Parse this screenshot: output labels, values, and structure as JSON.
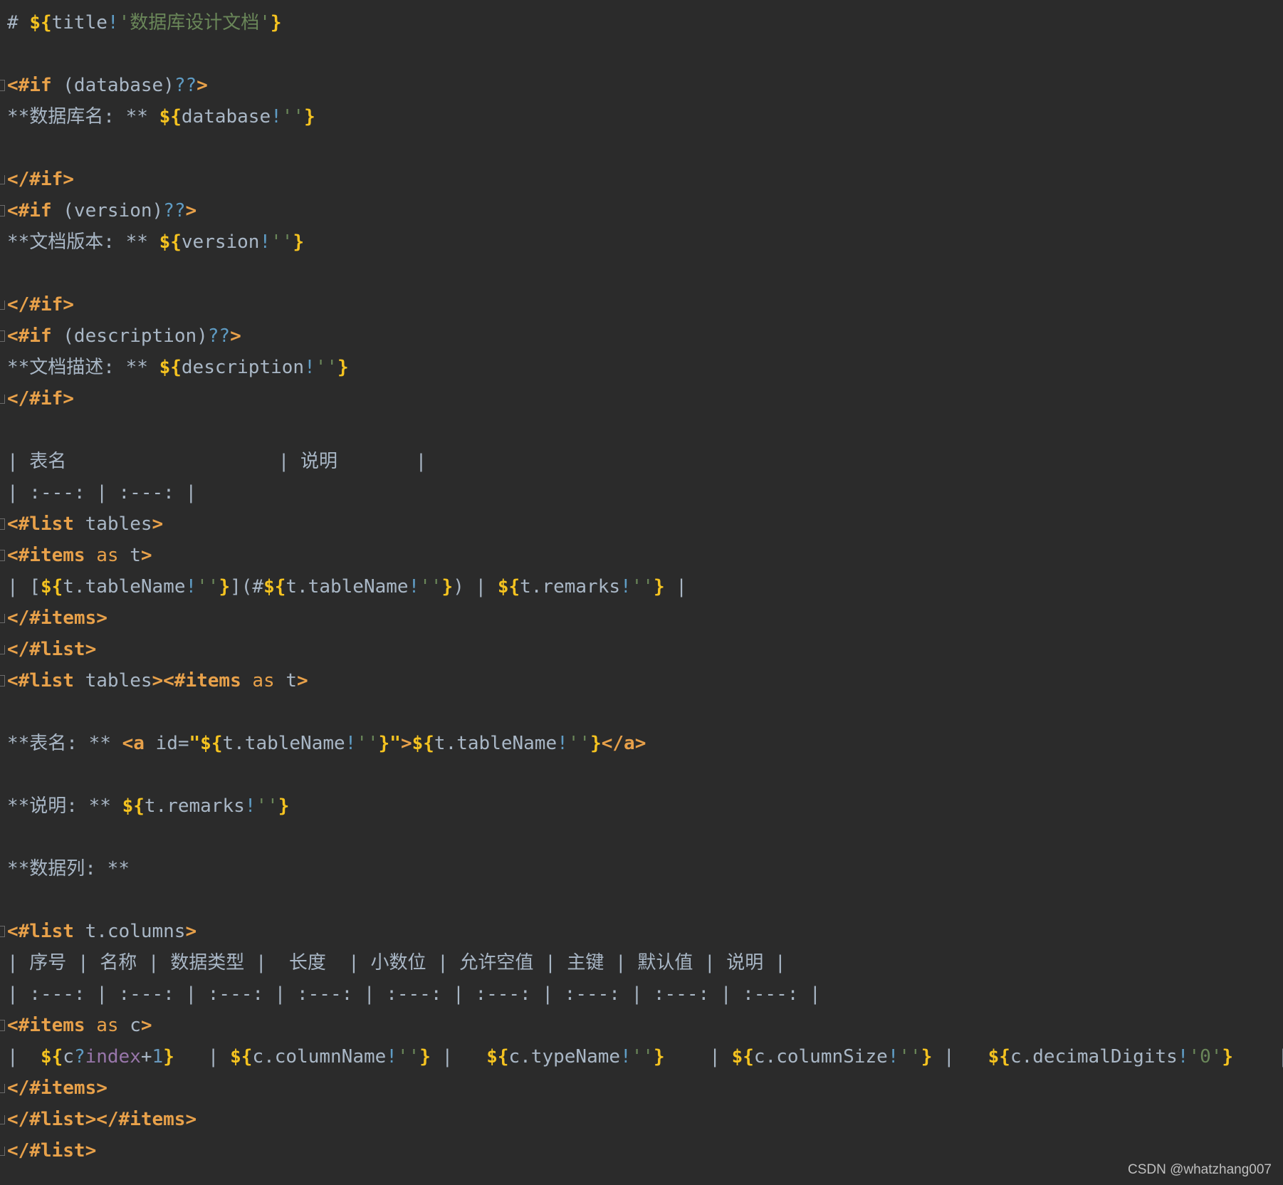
{
  "editor": {
    "lines": [
      {
        "fold": "",
        "tokens": [
          [
            "plain",
            "# "
          ],
          [
            "interp",
            "${"
          ],
          [
            "plain",
            "title"
          ],
          [
            "op",
            "!"
          ],
          [
            "str",
            "'数据库设计文档'"
          ],
          [
            "interp",
            "}"
          ]
        ]
      },
      {
        "fold": "",
        "tokens": []
      },
      {
        "fold": "start",
        "tokens": [
          [
            "tag",
            "<#if "
          ],
          [
            "plain",
            "(database)"
          ],
          [
            "op",
            "??"
          ],
          [
            "tag",
            ">"
          ]
        ]
      },
      {
        "fold": "",
        "tokens": [
          [
            "plain",
            "**数据库名: ** "
          ],
          [
            "interp",
            "${"
          ],
          [
            "plain",
            "database"
          ],
          [
            "op",
            "!"
          ],
          [
            "str",
            "''"
          ],
          [
            "interp",
            "}"
          ]
        ]
      },
      {
        "fold": "",
        "tokens": []
      },
      {
        "fold": "end",
        "tokens": [
          [
            "tag",
            "</#if>"
          ]
        ]
      },
      {
        "fold": "start",
        "tokens": [
          [
            "tag",
            "<#if "
          ],
          [
            "plain",
            "(version)"
          ],
          [
            "op",
            "??"
          ],
          [
            "tag",
            ">"
          ]
        ]
      },
      {
        "fold": "",
        "tokens": [
          [
            "plain",
            "**文档版本: ** "
          ],
          [
            "interp",
            "${"
          ],
          [
            "plain",
            "version"
          ],
          [
            "op",
            "!"
          ],
          [
            "str",
            "''"
          ],
          [
            "interp",
            "}"
          ]
        ]
      },
      {
        "fold": "",
        "tokens": []
      },
      {
        "fold": "end",
        "tokens": [
          [
            "tag",
            "</#if>"
          ]
        ]
      },
      {
        "fold": "start",
        "tokens": [
          [
            "tag",
            "<#if "
          ],
          [
            "plain",
            "(description)"
          ],
          [
            "op",
            "??"
          ],
          [
            "tag",
            ">"
          ]
        ]
      },
      {
        "fold": "",
        "tokens": [
          [
            "plain",
            "**文档描述: ** "
          ],
          [
            "interp",
            "${"
          ],
          [
            "plain",
            "description"
          ],
          [
            "op",
            "!"
          ],
          [
            "str",
            "''"
          ],
          [
            "interp",
            "}"
          ]
        ]
      },
      {
        "fold": "end",
        "tokens": [
          [
            "tag",
            "</#if>"
          ]
        ]
      },
      {
        "fold": "",
        "tokens": []
      },
      {
        "fold": "",
        "tokens": [
          [
            "plain",
            "| 表名                   | 说明       |"
          ]
        ]
      },
      {
        "fold": "",
        "tokens": [
          [
            "plain",
            "| :---: | :---: |"
          ]
        ]
      },
      {
        "fold": "start",
        "tokens": [
          [
            "tag",
            "<#list "
          ],
          [
            "plain",
            "tables"
          ],
          [
            "tag",
            ">"
          ]
        ]
      },
      {
        "fold": "start",
        "tokens": [
          [
            "tag",
            "<#items "
          ],
          [
            "kw",
            "as "
          ],
          [
            "plain",
            "t"
          ],
          [
            "tag",
            ">"
          ]
        ]
      },
      {
        "fold": "",
        "tokens": [
          [
            "plain",
            "| ["
          ],
          [
            "interp",
            "${"
          ],
          [
            "plain",
            "t.tableName"
          ],
          [
            "op",
            "!"
          ],
          [
            "str",
            "''"
          ],
          [
            "interp",
            "}"
          ],
          [
            "plain",
            "](#"
          ],
          [
            "interp",
            "${"
          ],
          [
            "plain",
            "t.tableName"
          ],
          [
            "op",
            "!"
          ],
          [
            "str",
            "''"
          ],
          [
            "interp",
            "}"
          ],
          [
            "plain",
            ") | "
          ],
          [
            "interp",
            "${"
          ],
          [
            "plain",
            "t.remarks"
          ],
          [
            "op",
            "!"
          ],
          [
            "str",
            "''"
          ],
          [
            "interp",
            "}"
          ],
          [
            "plain",
            " |"
          ]
        ]
      },
      {
        "fold": "end",
        "tokens": [
          [
            "tag",
            "</#items>"
          ]
        ]
      },
      {
        "fold": "end",
        "tokens": [
          [
            "tag",
            "</#list>"
          ]
        ]
      },
      {
        "fold": "start",
        "tokens": [
          [
            "tag",
            "<#list "
          ],
          [
            "plain",
            "tables"
          ],
          [
            "tag",
            ">"
          ],
          [
            "tag",
            "<#items "
          ],
          [
            "kw",
            "as "
          ],
          [
            "plain",
            "t"
          ],
          [
            "tag",
            ">"
          ]
        ]
      },
      {
        "fold": "",
        "tokens": []
      },
      {
        "fold": "",
        "tokens": [
          [
            "plain",
            "**表名: ** "
          ],
          [
            "tag",
            "<a "
          ],
          [
            "plain",
            "id="
          ],
          [
            "interp",
            "\""
          ],
          [
            "interp",
            "${"
          ],
          [
            "plain",
            "t.tableName"
          ],
          [
            "op",
            "!"
          ],
          [
            "str",
            "''"
          ],
          [
            "interp",
            "}"
          ],
          [
            "interp",
            "\""
          ],
          [
            "tag",
            ">"
          ],
          [
            "interp",
            "${"
          ],
          [
            "plain",
            "t.tableName"
          ],
          [
            "op",
            "!"
          ],
          [
            "str",
            "''"
          ],
          [
            "interp",
            "}"
          ],
          [
            "tag",
            "</a>"
          ]
        ]
      },
      {
        "fold": "",
        "tokens": []
      },
      {
        "fold": "",
        "tokens": [
          [
            "plain",
            "**说明: ** "
          ],
          [
            "interp",
            "${"
          ],
          [
            "plain",
            "t.remarks"
          ],
          [
            "op",
            "!"
          ],
          [
            "str",
            "''"
          ],
          [
            "interp",
            "}"
          ]
        ]
      },
      {
        "fold": "",
        "tokens": []
      },
      {
        "fold": "",
        "tokens": [
          [
            "plain",
            "**数据列: **"
          ]
        ]
      },
      {
        "fold": "",
        "tokens": []
      },
      {
        "fold": "start",
        "tokens": [
          [
            "tag",
            "<#list "
          ],
          [
            "plain",
            "t.columns"
          ],
          [
            "tag",
            ">"
          ]
        ]
      },
      {
        "fold": "",
        "tokens": [
          [
            "plain",
            "| 序号 | 名称 | 数据类型 |  长度  | 小数位 | 允许空值 | 主键 | 默认值 | 说明 |"
          ]
        ]
      },
      {
        "fold": "",
        "tokens": [
          [
            "plain",
            "| :---: | :---: | :---: | :---: | :---: | :---: | :---: | :---: | :---: |"
          ]
        ]
      },
      {
        "fold": "start",
        "tokens": [
          [
            "tag",
            "<#items "
          ],
          [
            "kw",
            "as "
          ],
          [
            "plain",
            "c"
          ],
          [
            "tag",
            ">"
          ]
        ]
      },
      {
        "fold": "",
        "tokens": [
          [
            "plain",
            "|  "
          ],
          [
            "interp",
            "${"
          ],
          [
            "plain",
            "c"
          ],
          [
            "op",
            "?"
          ],
          [
            "builtin",
            "index"
          ],
          [
            "plain",
            "+"
          ],
          [
            "num",
            "1"
          ],
          [
            "interp",
            "}"
          ],
          [
            "plain",
            "   | "
          ],
          [
            "interp",
            "${"
          ],
          [
            "plain",
            "c.columnName"
          ],
          [
            "op",
            "!"
          ],
          [
            "str",
            "''"
          ],
          [
            "interp",
            "}"
          ],
          [
            "plain",
            " |   "
          ],
          [
            "interp",
            "${"
          ],
          [
            "plain",
            "c.typeName"
          ],
          [
            "op",
            "!"
          ],
          [
            "str",
            "''"
          ],
          [
            "interp",
            "}"
          ],
          [
            "plain",
            "    | "
          ],
          [
            "interp",
            "${"
          ],
          [
            "plain",
            "c.columnSize"
          ],
          [
            "op",
            "!"
          ],
          [
            "str",
            "''"
          ],
          [
            "interp",
            "}"
          ],
          [
            "plain",
            " |   "
          ],
          [
            "interp",
            "${"
          ],
          [
            "plain",
            "c.decimalDigits"
          ],
          [
            "op",
            "!"
          ],
          [
            "str",
            "'0'"
          ],
          [
            "interp",
            "}"
          ],
          [
            "plain",
            "    |"
          ]
        ]
      },
      {
        "fold": "end",
        "tokens": [
          [
            "tag",
            "</#items>"
          ]
        ]
      },
      {
        "fold": "end",
        "tokens": [
          [
            "tag",
            "</#list>"
          ],
          [
            "tag",
            "</#items>"
          ]
        ]
      },
      {
        "fold": "end",
        "tokens": [
          [
            "tag",
            "</#list>"
          ]
        ]
      }
    ]
  },
  "watermark": "CSDN @whatzhang007",
  "colors": {
    "background": "#2b2b2b",
    "tag": "#e8a14a",
    "interpolation": "#f5c320",
    "plain": "#a9b7c6",
    "string": "#6a8759",
    "operator": "#5f9cc4",
    "builtin": "#9876aa"
  }
}
